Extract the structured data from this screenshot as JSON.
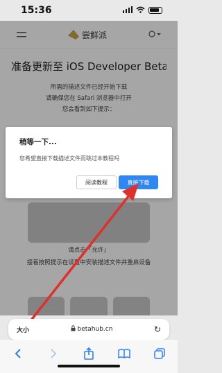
{
  "status": {
    "time": "15:36",
    "signal": "..ll",
    "wifi": "wifi"
  },
  "nav": {
    "menu_icon": "menu-icon",
    "brand": "尝鲜派",
    "lang_icon": "globe-icon"
  },
  "page": {
    "title": "准备更新至 iOS Developer Beta...",
    "lines": [
      "所需的描述文件已经开始下载",
      "请确保您在 Safari 浏览器中打开",
      "您会看到如下提示："
    ],
    "step_lines": [
      "请点击「允许」",
      "接着按照提示在设置中安装描述文件并重启设备"
    ]
  },
  "dialog": {
    "title": "稍等一下...",
    "body": "您希望直接下载描述文件而跳过本教程吗",
    "read_label": "阅读教程",
    "download_label": "直接下载"
  },
  "browser": {
    "aa_label": "大小",
    "url": "betahub.cn"
  },
  "colors": {
    "accent": "#2f87f4",
    "arrow": "#e0302b"
  }
}
